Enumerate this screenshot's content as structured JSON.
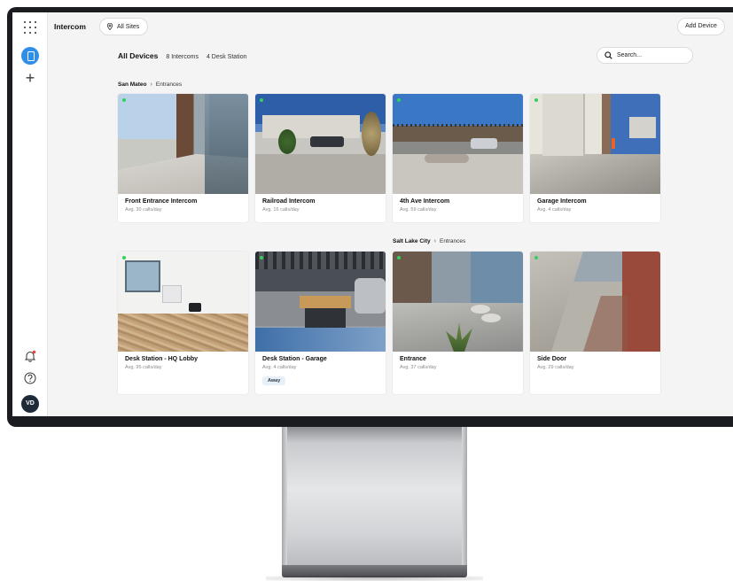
{
  "app": {
    "title": "Intercom",
    "site_filter": "All Sites",
    "add_device_label": "Add Device"
  },
  "user": {
    "initials": "VD"
  },
  "filters": {
    "all": "All Devices",
    "intercoms": "8 Intercoms",
    "desk_station": "4 Desk Station"
  },
  "search": {
    "placeholder": "Search..."
  },
  "groups": [
    {
      "location": "San Mateo",
      "area": "Entrances"
    },
    {
      "location": "Salt Lake City",
      "area": "Entrances"
    }
  ],
  "devices": [
    {
      "name": "Front Entrance Intercom",
      "calls": "Avg. 30 calls/day"
    },
    {
      "name": "Railroad Intercom",
      "calls": "Avg. 16 calls/day"
    },
    {
      "name": "4th Ave Intercom",
      "calls": "Avg. 59 calls/day"
    },
    {
      "name": "Garage Intercom",
      "calls": "Avg. 4 calls/day"
    },
    {
      "name": "Desk Station - HQ Lobby",
      "calls": "Avg. 95 calls/day"
    },
    {
      "name": "Desk Station - Garage",
      "calls": "Avg. 4 calls/day",
      "badge": "Away"
    },
    {
      "name": "Entrance",
      "calls": "Avg. 37 calls/day"
    },
    {
      "name": "Side Door",
      "calls": "Avg. 29 calls/day"
    }
  ],
  "colors": {
    "accent": "#2f8fe6",
    "online": "#32d15a",
    "avatar_bg": "#1f2a38",
    "away_badge_bg": "#e7f0f7"
  }
}
